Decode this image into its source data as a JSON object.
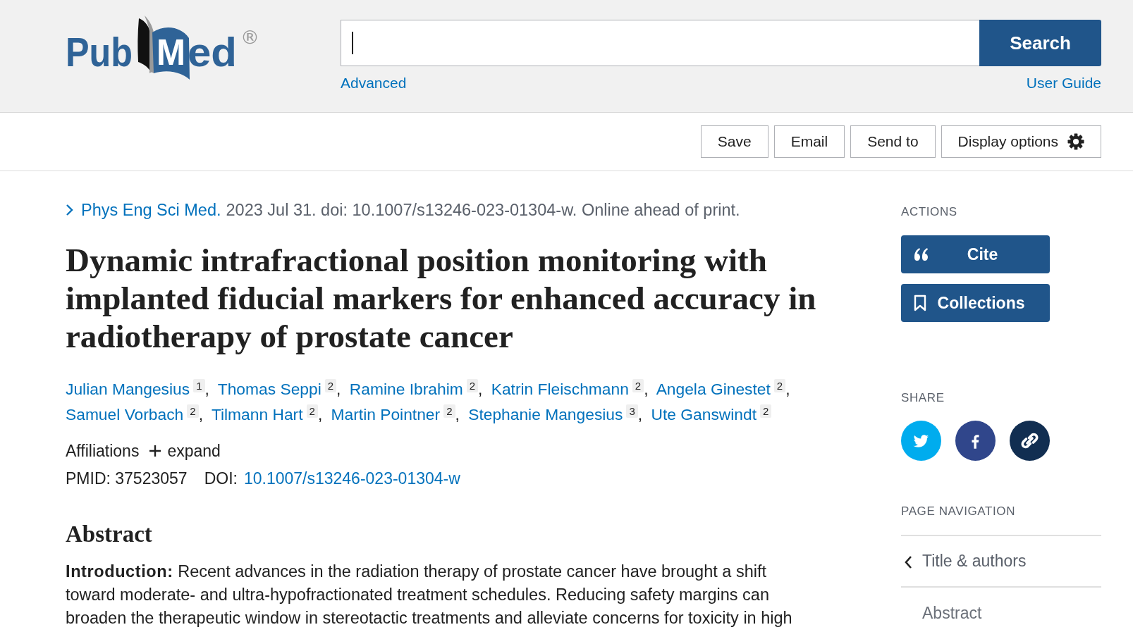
{
  "header": {
    "logo": {
      "before_book": "Pub",
      "on_book": "M",
      "after_book": "ed",
      "registered_mark": "®"
    },
    "search": {
      "focused": true,
      "button": "Search"
    },
    "links": [
      "Advanced",
      "User Guide"
    ]
  },
  "toolbar": {
    "buttons": [
      {
        "label": "Save",
        "kind": "plain"
      },
      {
        "label": "Email",
        "kind": "plain"
      },
      {
        "label": "Send to",
        "kind": "plain"
      },
      {
        "label": "Display options",
        "kind": "gear"
      }
    ]
  },
  "article": {
    "journal": "Phys Eng Sci Med.",
    "citation": "2023 Jul 31. doi: 10.1007/s13246-023-01304-w. Online ahead of print.",
    "title": "Dynamic intrafractional position monitoring with implanted fiducial markers for enhanced accuracy in radiotherapy of prostate cancer",
    "author_separator": ",",
    "authors": [
      {
        "name": "Julian Mangesius",
        "affiliation": "1"
      },
      {
        "name": "Thomas Seppi",
        "affiliation": "2"
      },
      {
        "name": "Ramine Ibrahim",
        "affiliation": "2"
      },
      {
        "name": "Katrin Fleischmann",
        "affiliation": "2"
      },
      {
        "name": "Angela Ginestet",
        "affiliation": "2"
      },
      {
        "name": "Samuel Vorbach",
        "affiliation": "2"
      },
      {
        "name": "Tilmann Hart",
        "affiliation": "2"
      },
      {
        "name": "Martin Pointner",
        "affiliation": "2"
      },
      {
        "name": "Stephanie Mangesius",
        "affiliation": "3"
      },
      {
        "name": "Ute Ganswindt",
        "affiliation": "2"
      }
    ],
    "affiliations": {
      "label": "Affiliations",
      "toggle": "expand",
      "expanded": false
    },
    "pmid": {
      "label": "PMID:",
      "value": "37523057"
    },
    "doi": {
      "label": "DOI:",
      "value": "10.1007/s13246-023-01304-w"
    }
  },
  "abstract": {
    "heading": "Abstract",
    "paragraphs": [
      "**Introduction:** Recent advances in the radiation therapy of prostate cancer have brought a shift toward moderate- and ultra-hypofractionated treatment schedules. Reducing safety margins can broaden the therapeutic window in stereotactic treatments and alleviate concerns for toxicity in high"
    ]
  },
  "sidebar": {
    "actions": {
      "heading": "ACTIONS",
      "buttons": [
        {
          "label": "Cite",
          "kind": "quote"
        },
        {
          "label": "Collections",
          "kind": "bookmark"
        }
      ]
    },
    "share": {
      "heading": "SHARE",
      "items": [
        {
          "kind": "bird",
          "color": "#00acee"
        },
        {
          "kind": "letter-f",
          "color": "#30468b"
        },
        {
          "kind": "link",
          "color": "#112e51"
        }
      ]
    },
    "page_navigation": {
      "heading": "PAGE NAVIGATION",
      "items": [
        {
          "label": "Title & authors",
          "selected": true
        },
        {
          "label": "Abstract",
          "selected": false
        }
      ]
    }
  }
}
